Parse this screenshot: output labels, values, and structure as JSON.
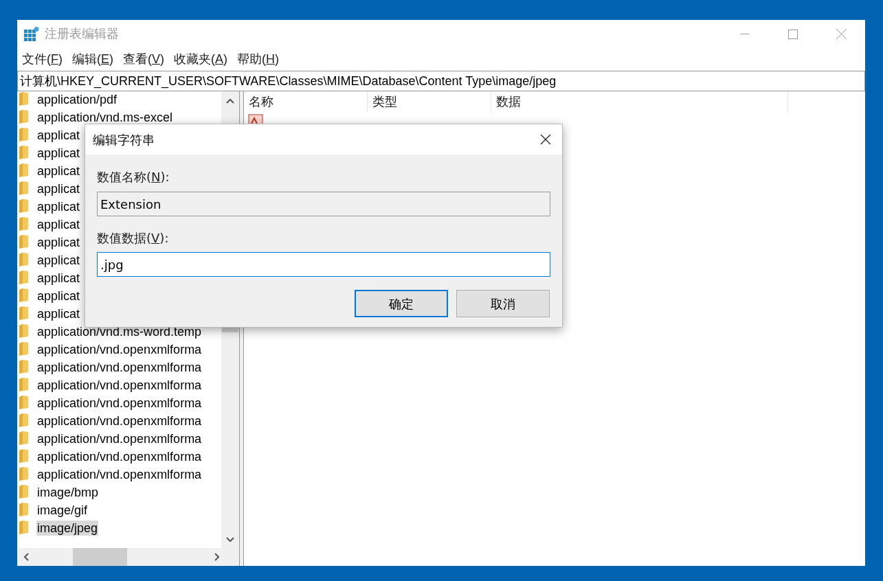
{
  "window": {
    "title": "注册表编辑器"
  },
  "menu": [
    {
      "label": "文件(F)"
    },
    {
      "label": "编辑(E)"
    },
    {
      "label": "查看(V)"
    },
    {
      "label": "收藏夹(A)"
    },
    {
      "label": "帮助(H)"
    }
  ],
  "address": "计算机\\HKEY_CURRENT_USER\\SOFTWARE\\Classes\\MIME\\Database\\Content Type\\image/jpeg",
  "tree": [
    {
      "label": "application/pdf",
      "selected": false
    },
    {
      "label": "application/vnd.ms-excel",
      "selected": false
    },
    {
      "label": "applicat",
      "selected": false
    },
    {
      "label": "applicat",
      "selected": false
    },
    {
      "label": "applicat",
      "selected": false
    },
    {
      "label": "applicat",
      "selected": false
    },
    {
      "label": "applicat",
      "selected": false
    },
    {
      "label": "applicat",
      "selected": false
    },
    {
      "label": "applicat",
      "selected": false
    },
    {
      "label": "applicat",
      "selected": false
    },
    {
      "label": "applicat",
      "selected": false
    },
    {
      "label": "applicat",
      "selected": false
    },
    {
      "label": "applicat",
      "selected": false
    },
    {
      "label": "application/vnd.ms-word.temp",
      "selected": false
    },
    {
      "label": "application/vnd.openxmlforma",
      "selected": false
    },
    {
      "label": "application/vnd.openxmlforma",
      "selected": false
    },
    {
      "label": "application/vnd.openxmlforma",
      "selected": false
    },
    {
      "label": "application/vnd.openxmlforma",
      "selected": false
    },
    {
      "label": "application/vnd.openxmlforma",
      "selected": false
    },
    {
      "label": "application/vnd.openxmlforma",
      "selected": false
    },
    {
      "label": "application/vnd.openxmlforma",
      "selected": false
    },
    {
      "label": "application/vnd.openxmlforma",
      "selected": false
    },
    {
      "label": "image/bmp",
      "selected": false
    },
    {
      "label": "image/gif",
      "selected": false
    },
    {
      "label": "image/jpeg",
      "selected": true
    }
  ],
  "table": {
    "columns": [
      "名称",
      "类型",
      "数据"
    ]
  },
  "dialog": {
    "title": "编辑字符串",
    "name_label": "数值名称(N):",
    "name_value": "Extension",
    "data_label": "数值数据(V):",
    "data_value": ".jpg",
    "buttons": [
      {
        "label": "确定",
        "default": true
      },
      {
        "label": "取消",
        "default": false
      }
    ]
  }
}
